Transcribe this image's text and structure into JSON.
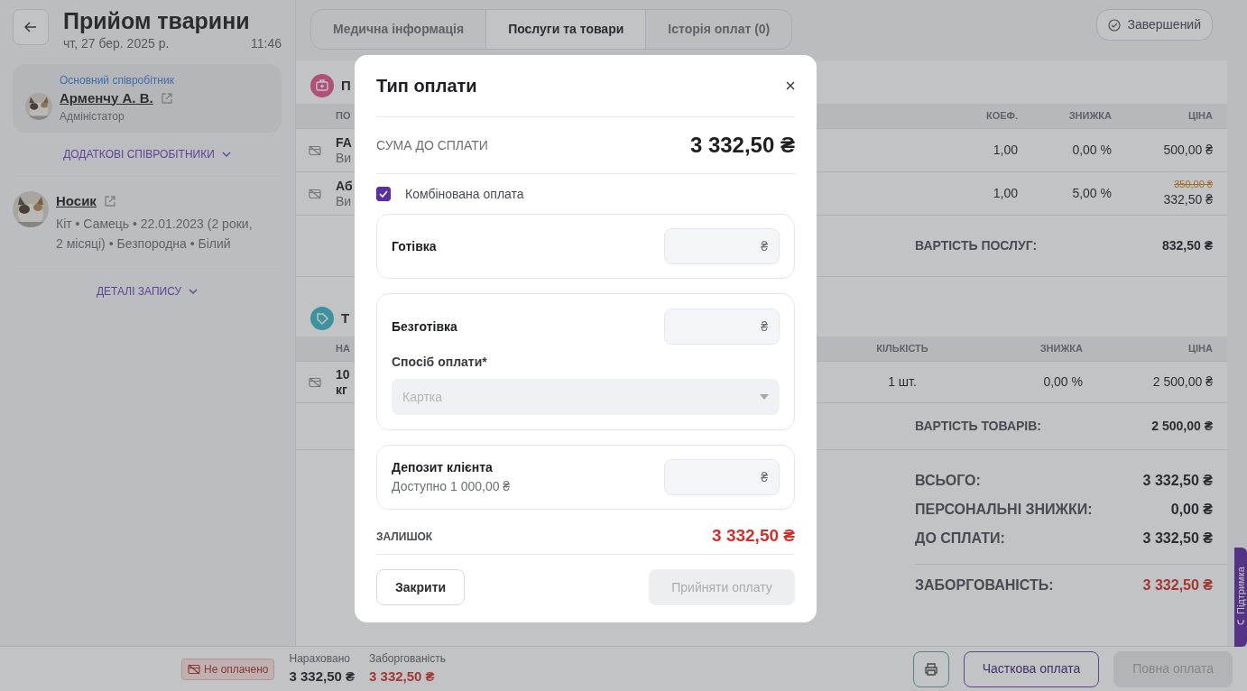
{
  "header": {
    "title": "Прийом тварини",
    "date": "чт, 27 бер. 2025 р.",
    "time": "11:46"
  },
  "employee": {
    "role_label": "Основний співробітник",
    "name": "Арменчу А. В.",
    "position": "Адміністатор"
  },
  "additional_staff": {
    "label": "ДОДАТКОВІ СПІВРОБІТНИКИ",
    "expanded": false
  },
  "patient": {
    "name": "Носик",
    "details": "Кіт • Самець • 22.01.2023 (2 роки, 2 місяці) • Безпородна • Білий"
  },
  "record_details": {
    "label": "ДЕТАЛІ ЗАПИСУ",
    "expanded": false
  },
  "tabs": [
    {
      "label": "Медична інформація",
      "selected": false
    },
    {
      "label": "Послуги та товари",
      "selected": true
    },
    {
      "label": "Історія оплат (0)",
      "selected": false
    }
  ],
  "status_button": "Завершений",
  "sections": [
    {
      "kind": "services",
      "title": "П",
      "name_column": "ПО",
      "columns": [
        "КОЕФ.",
        "ЗНИЖКА",
        "ЦІНА"
      ],
      "rows": [
        {
          "item": {
            "name": "FA",
            "sub": "Ви"
          },
          "cells": [
            "1,00",
            "0,00 %",
            "500,00 ₴"
          ]
        },
        {
          "item": {
            "name": "Аб",
            "sub": "Ви"
          },
          "old_price": "350,00 ₴",
          "cells": [
            "1,00",
            "5,00 %",
            "332,50 ₴"
          ]
        }
      ],
      "total_label": "ВАРТІСТЬ ПОСЛУГ:",
      "total": "832,50 ₴"
    },
    {
      "kind": "goods",
      "title": "Т",
      "name_column": "НА",
      "columns": [
        "КІЛЬКІСТЬ",
        "ЗНИЖКА",
        "ЦІНА"
      ],
      "rows": [
        {
          "item": {
            "name": "10",
            "sub": "кг"
          },
          "cells": [
            "1 шт.",
            "0,00 %",
            "2 500,00 ₴"
          ]
        }
      ],
      "total_label": "ВАРТІСТЬ ТОВАРІВ:",
      "total": "2 500,00 ₴"
    }
  ],
  "summary": [
    {
      "label": "ВСЬОГО:",
      "value": "3 332,50 ₴",
      "kind": "normal"
    },
    {
      "label": "ПЕРСОНАЛЬНІ ЗНИЖКИ:",
      "value": "0,00 ₴",
      "kind": "normal"
    },
    {
      "label": "ДО СПЛАТИ:",
      "value": "3 332,50 ₴",
      "kind": "normal"
    },
    {
      "label": "ЗАБОРГОВАНІСТЬ:",
      "value": "3 332,50 ₴",
      "kind": "debt"
    }
  ],
  "support_tab": "Підтримка",
  "footer": {
    "status": "Не оплачено",
    "charged_label": "Нараховано",
    "charged": "3 332,50 ₴",
    "debt_label": "Заборгованість",
    "debt": "3 332,50 ₴",
    "buttons": [
      {
        "label": "Часткова оплата",
        "disabled": false
      },
      {
        "label": "Повна оплата",
        "disabled": true
      }
    ]
  },
  "modal": {
    "title": "Тип оплати",
    "amount_label": "СУМА ДО СПЛАТИ",
    "amount": "3 332,50 ₴",
    "combined": {
      "label": "Комбінована оплата",
      "checked": true
    },
    "methods": [
      {
        "kind": "cash",
        "label": "Готівка",
        "currency": "₴"
      },
      {
        "kind": "card",
        "label": "Безготівка",
        "currency": "₴",
        "select_label": "Спосіб оплати*",
        "select_placeholder": "Картка"
      },
      {
        "kind": "deposit",
        "label": "Депозит клієнта",
        "note": "Доступно 1 000,00 ₴",
        "currency": "₴"
      }
    ],
    "remainder_label": "ЗАЛИШОК",
    "remainder": "3 332,50 ₴",
    "buttons": [
      {
        "label": "Закрити",
        "disabled": false
      },
      {
        "label": "Прийняти оплату",
        "disabled": true
      }
    ]
  }
}
